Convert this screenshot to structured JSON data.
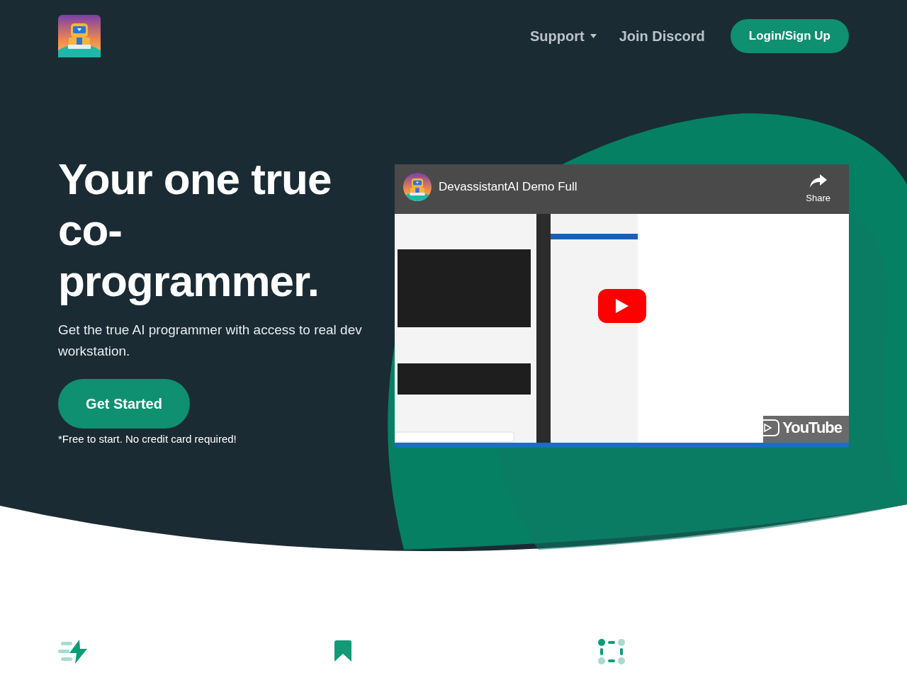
{
  "nav": [
    {
      "label": "Support",
      "kind": "dropdown"
    },
    {
      "label": "Join Discord",
      "kind": "link"
    },
    {
      "label": "Login/Sign Up",
      "kind": "button"
    }
  ],
  "hero": {
    "heading": "Your one true co-programmer.",
    "subtitle": "Get the true AI programmer with access to real dev workstation.",
    "cta": "Get Started",
    "note": "*Free to start. No credit card required!"
  },
  "video": {
    "title": "DevassistantAI Demo Full",
    "share": "Share",
    "logo": "YouTube"
  },
  "features": [
    {
      "kind": "bolt"
    },
    {
      "kind": "bookmark"
    },
    {
      "kind": "grid"
    }
  ]
}
